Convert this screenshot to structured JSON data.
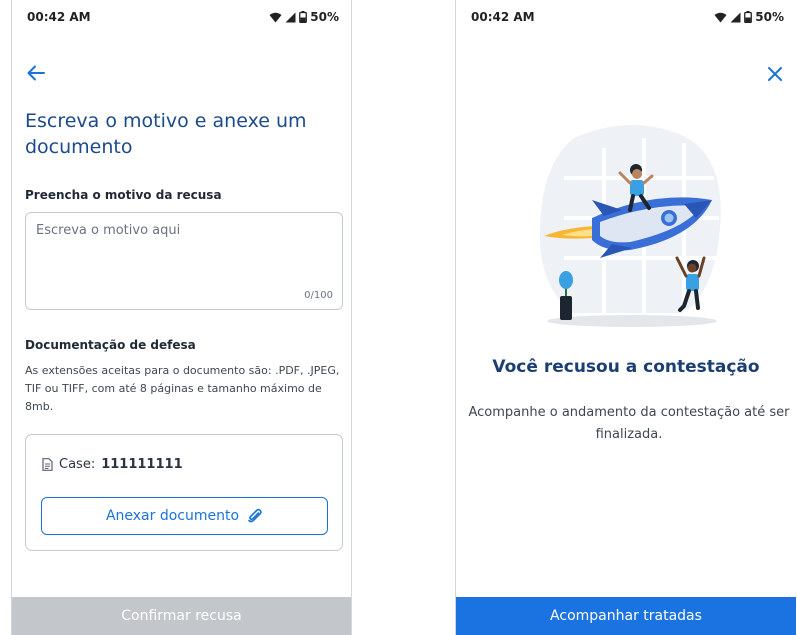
{
  "left_screen": {
    "status_bar": {
      "time": "00:42 AM",
      "battery": "50%"
    },
    "title": "Escreva o motivo e anexe um documento",
    "reason_label": "Preencha o motivo da recusa",
    "reason_input": {
      "value": "",
      "placeholder": "Escreva o motivo aqui",
      "counter": "0/100"
    },
    "defense_label": "Documentação de defesa",
    "defense_description": "As extensões aceitas para o documento são: .PDF, .JPEG, TIF ou TIFF, com até 8 páginas e tamanho máximo de 8mb.",
    "case_card": {
      "case_prefix": "Case:",
      "case_value": "111111111",
      "attach_label": "Anexar documento"
    },
    "confirm_label": "Confirmar recusa"
  },
  "right_screen": {
    "status_bar": {
      "time": "00:42 AM",
      "battery": "50%"
    },
    "success_title": "Você recusou a contestação",
    "success_description": "Acompanhe o andamento da contestação até ser finalizada.",
    "track_label": "Acompanhar tratadas"
  },
  "colors": {
    "primary": "#1a73e0",
    "title_blue": "#1c4a8a",
    "disabled_button": "#c3c6ca"
  },
  "icons": [
    "back-arrow-icon",
    "wifi-icon",
    "signal-icon",
    "battery-icon",
    "document-icon",
    "paperclip-icon",
    "close-icon"
  ]
}
